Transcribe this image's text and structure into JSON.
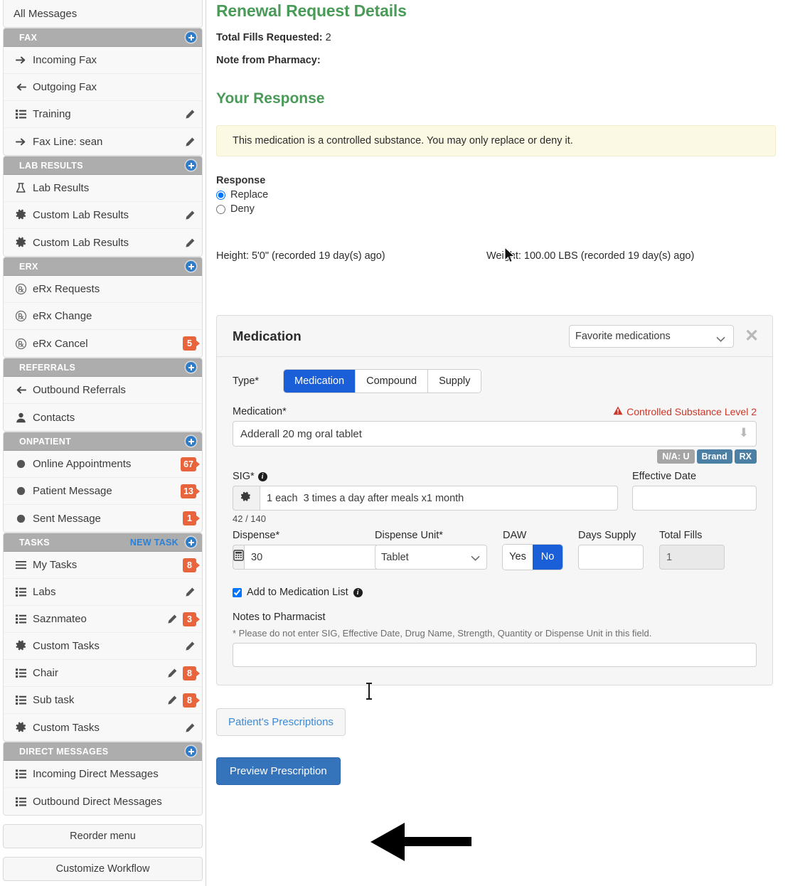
{
  "accent": {
    "green": "#4a9a58",
    "blue": "#1a5ed8",
    "steel": "#4b7fa3",
    "badge_orange": "#e8643c",
    "section_gray": "#adadad",
    "warn_red": "#c9392b",
    "banner_bg": "#fbf8e3",
    "link_blue": "#3b8ad6",
    "primary_btn": "#3573ba"
  },
  "sidebar": {
    "top_item": {
      "label": "All Messages",
      "icon": "none"
    },
    "sections": [
      {
        "title": "FAX",
        "add_icon": "plus-circle-icon",
        "items": [
          {
            "label": "Incoming Fax",
            "icon": "arrow-right-icon",
            "pencil": false,
            "badge": ""
          },
          {
            "label": "Outgoing Fax",
            "icon": "arrow-left-icon",
            "pencil": false,
            "badge": ""
          },
          {
            "label": "Training",
            "icon": "list-icon",
            "pencil": true,
            "badge": ""
          },
          {
            "label": "Fax Line: sean",
            "icon": "arrow-right-icon",
            "pencil": true,
            "badge": ""
          }
        ]
      },
      {
        "title": "LAB RESULTS",
        "add_icon": "plus-circle-icon",
        "items": [
          {
            "label": "Lab Results",
            "icon": "flask-icon",
            "pencil": false,
            "badge": ""
          },
          {
            "label": "Custom Lab Results",
            "icon": "gear-icon",
            "pencil": true,
            "badge": ""
          },
          {
            "label": "Custom Lab Results",
            "icon": "gear-icon",
            "pencil": true,
            "badge": ""
          }
        ]
      },
      {
        "title": "ERX",
        "add_icon": "plus-circle-icon",
        "items": [
          {
            "label": "eRx Requests",
            "icon": "rx-circle-icon",
            "pencil": false,
            "badge": ""
          },
          {
            "label": "eRx Change",
            "icon": "rx-circle-icon",
            "pencil": false,
            "badge": ""
          },
          {
            "label": "eRx Cancel",
            "icon": "rx-circle-icon",
            "pencil": false,
            "badge": "5"
          }
        ]
      },
      {
        "title": "REFERRALS",
        "add_icon": "plus-circle-icon",
        "items": [
          {
            "label": "Outbound Referrals",
            "icon": "arrow-left-icon",
            "pencil": false,
            "badge": ""
          },
          {
            "label": "Contacts",
            "icon": "person-icon",
            "pencil": false,
            "badge": ""
          }
        ]
      },
      {
        "title": "ONPATIENT",
        "add_icon": "plus-circle-icon",
        "items": [
          {
            "label": "Online Appointments",
            "icon": "dot-icon",
            "pencil": false,
            "badge": "67"
          },
          {
            "label": "Patient Message",
            "icon": "dot-icon",
            "pencil": false,
            "badge": "13"
          },
          {
            "label": "Sent Message",
            "icon": "dot-icon",
            "pencil": false,
            "badge": "1"
          }
        ]
      },
      {
        "title": "TASKS",
        "action_label": "NEW TASK",
        "add_icon": "plus-circle-icon",
        "items": [
          {
            "label": "My Tasks",
            "icon": "hamburger-icon",
            "pencil": false,
            "badge": "8"
          },
          {
            "label": "Labs",
            "icon": "list-icon",
            "pencil": true,
            "badge": ""
          },
          {
            "label": "Saznmateo",
            "icon": "list-icon",
            "pencil": true,
            "badge": "3"
          },
          {
            "label": "Custom Tasks",
            "icon": "gear-icon",
            "pencil": true,
            "badge": ""
          },
          {
            "label": "Chair",
            "icon": "list-icon",
            "pencil": true,
            "badge": "8"
          },
          {
            "label": "Sub task",
            "icon": "list-icon",
            "pencil": true,
            "badge": "8"
          },
          {
            "label": "Custom Tasks",
            "icon": "gear-icon",
            "pencil": true,
            "badge": ""
          }
        ]
      },
      {
        "title": "DIRECT MESSAGES",
        "add_icon": "plus-circle-icon",
        "items": [
          {
            "label": "Incoming Direct Messages",
            "icon": "list-icon",
            "pencil": false,
            "badge": ""
          },
          {
            "label": "Outbound Direct Messages",
            "icon": "list-icon",
            "pencil": false,
            "badge": ""
          }
        ]
      }
    ],
    "footer_buttons": [
      {
        "label": "Reorder menu"
      },
      {
        "label": "Customize Workflow"
      }
    ]
  },
  "main": {
    "page_title": "Renewal Request Details",
    "total_fills_label": "Total Fills Requested:",
    "total_fills_value": "2",
    "pharmacy_note_label": "Note from Pharmacy:",
    "pharmacy_note_value": "",
    "response_heading": "Your Response",
    "warning_banner": "This medication is a controlled substance. You may only replace or deny it.",
    "response_label": "Response",
    "response_options": [
      {
        "label": "Replace",
        "selected": true
      },
      {
        "label": "Deny",
        "selected": false
      }
    ],
    "vitals": {
      "height": "Height: 5'0\" (recorded 19 day(s) ago)",
      "weight": "Weight: 100.00 LBS (recorded 19 day(s) ago)"
    }
  },
  "medication_card": {
    "title": "Medication",
    "favorites_select": {
      "value": "Favorite medications",
      "options": [
        "Favorite medications"
      ]
    },
    "close_icon": "close-icon",
    "type": {
      "label": "Type*",
      "options": [
        {
          "label": "Medication",
          "selected": true
        },
        {
          "label": "Compound",
          "selected": false
        },
        {
          "label": "Supply",
          "selected": false
        }
      ]
    },
    "medication": {
      "label": "Medication*",
      "warning": "Controlled Substance Level 2",
      "warning_icon": "warning-triangle-icon",
      "value": "Adderall 20 mg oral tablet",
      "placeholder": "",
      "dropdown_icon": "arrow-down-icon",
      "pills": [
        {
          "text": "N/A: U",
          "style": "gray"
        },
        {
          "text": "Brand",
          "style": "steel"
        },
        {
          "text": "RX",
          "style": "steel"
        }
      ]
    },
    "sig": {
      "label": "SIG*",
      "info_icon": "info-icon",
      "builder_icon": "gear-icon",
      "value": "1 each  3 times a day after meals x1 month",
      "placeholder": "",
      "counter": "42 / 140"
    },
    "effective_date": {
      "label": "Effective Date",
      "value": "",
      "placeholder": ""
    },
    "dispense": {
      "label": "Dispense*",
      "calc_icon": "calculator-icon",
      "value": "30",
      "placeholder": ""
    },
    "dispense_unit": {
      "label": "Dispense Unit*",
      "value": "Tablet",
      "options": [
        "Tablet"
      ]
    },
    "daw": {
      "label": "DAW",
      "options": [
        {
          "label": "Yes",
          "selected": false
        },
        {
          "label": "No",
          "selected": true
        }
      ]
    },
    "days_supply": {
      "label": "Days Supply",
      "value": "",
      "placeholder": ""
    },
    "total_fills": {
      "label": "Total Fills",
      "value": "1",
      "readonly": true
    },
    "add_to_list": {
      "label": "Add to Medication List",
      "checked": true,
      "info_icon": "info-icon"
    },
    "notes": {
      "label": "Notes to Pharmacist",
      "hint": "* Please do not enter SIG, Effective Date, Drug Name, Strength, Quantity or Dispense Unit in this field.",
      "value": "",
      "placeholder": ""
    }
  },
  "actions": {
    "patients_prescriptions": "Patient's Prescriptions",
    "preview_prescription": "Preview Prescription"
  }
}
